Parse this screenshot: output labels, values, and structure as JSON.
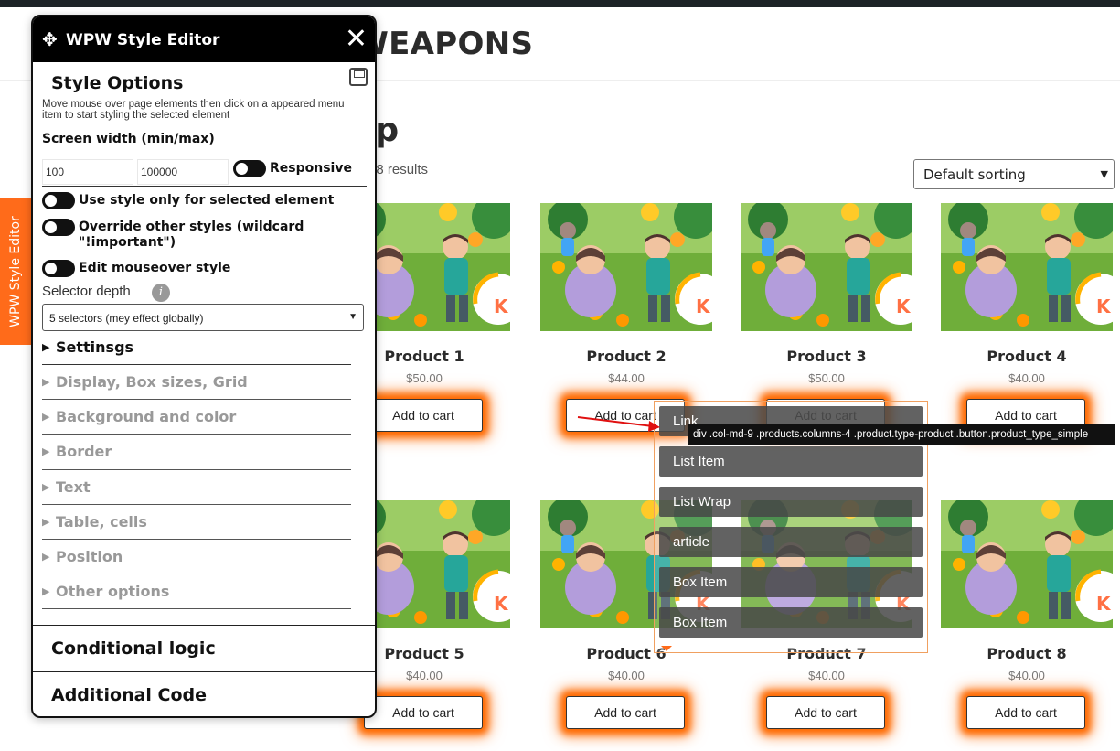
{
  "site": {
    "title": "P WEAPONS"
  },
  "shop": {
    "title": "hop",
    "result_count": "ing all 8 results",
    "sort": {
      "selected": "Default sorting"
    }
  },
  "products": [
    {
      "name": "Product 1",
      "price": "$50.00",
      "button": "Add to cart"
    },
    {
      "name": "Product 2",
      "price": "$44.00",
      "button": "Add to cart"
    },
    {
      "name": "Product 3",
      "price": "$50.00",
      "button": "Add to cart"
    },
    {
      "name": "Product 4",
      "price": "$40.00",
      "button": "Add to cart"
    },
    {
      "name": "Product 5",
      "price": "$40.00",
      "button": "Add to cart"
    },
    {
      "name": "Product 6",
      "price": "$40.00",
      "button": "Add to cart"
    },
    {
      "name": "Product 7",
      "price": "$40.00",
      "button": "Add to cart"
    },
    {
      "name": "Product 8",
      "price": "$40.00",
      "button": "Add to cart"
    }
  ],
  "side_tab": {
    "label": "WPW Style Editor"
  },
  "editor": {
    "title": "WPW Style Editor",
    "close_icon": "close-icon",
    "move_icon": "move-icon",
    "save_icon": "save-icon",
    "style_options": "Style Options",
    "hint": "Move mouse over page elements then click on a appeared menu item to start styling the selected element",
    "screen_width_label": "Screen width (min/max)",
    "min_width": "100",
    "max_width": "100000",
    "responsive_label": "Responsive",
    "toggles": [
      {
        "label": "Use style only for selected element"
      },
      {
        "label": "Override other styles (wildcard \"!important\")"
      },
      {
        "label": "Edit mouseover style"
      }
    ],
    "selector_depth_label": "Selector depth",
    "selector_depth_value": "5 selectors (mey effect globally)",
    "accordion": [
      {
        "label": "Settinsgs"
      },
      {
        "label": "Display, Box sizes, Grid"
      },
      {
        "label": "Background and color"
      },
      {
        "label": "Border"
      },
      {
        "label": "Text"
      },
      {
        "label": "Table, cells"
      },
      {
        "label": "Position"
      },
      {
        "label": "Other options"
      }
    ],
    "conditional_logic": "Conditional logic",
    "additional_code": "Additional Code"
  },
  "picker": {
    "tooltip": "div .col-md-9 .products.columns-4 .product.type-product .button.product_type_simple",
    "items": [
      {
        "label": "Link"
      },
      {
        "label": "List Item"
      },
      {
        "label": "List Wrap"
      },
      {
        "label": "article"
      },
      {
        "label": "Box Item"
      },
      {
        "label": "Box Item"
      }
    ]
  },
  "colors": {
    "accent": "#ff6b1a",
    "glow": "#ff6a00",
    "panel_header": "#000000"
  }
}
